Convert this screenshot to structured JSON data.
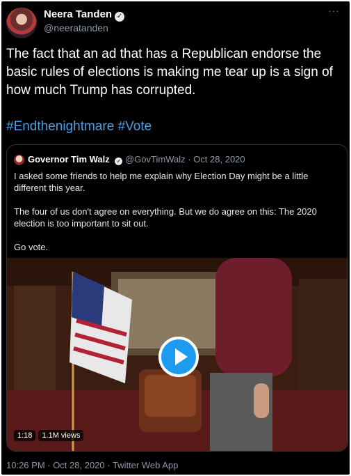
{
  "tweet": {
    "author_name": "Neera Tanden",
    "author_handle": "@neeratanden",
    "more_icon": "more-icon",
    "text": "The fact that an ad that has a Republican endorse the basic rules of elections is making me tear up is a sign of how much Trump has corrupted.",
    "hashtags": [
      "#Endthenightmare",
      "#Vote"
    ],
    "footer": "10:26 PM · Oct 28, 2020 · Twitter Web App"
  },
  "quote": {
    "author_name": "Governor Tim Walz",
    "author_handle": "@GovTimWalz",
    "date": "· Oct 28, 2020",
    "paragraphs": [
      "I asked some friends to help me explain why Election Day might be a little different this year.",
      "The four of us don't agree on everything. But we do agree on this: The 2020 election is too important to sit out.",
      "Go vote."
    ],
    "video": {
      "duration": "1:18",
      "views": "1.1M views"
    }
  },
  "colors": {
    "background": "#000000",
    "hashtag": "#4a9fe6",
    "play_button": "#1d9bf0"
  }
}
